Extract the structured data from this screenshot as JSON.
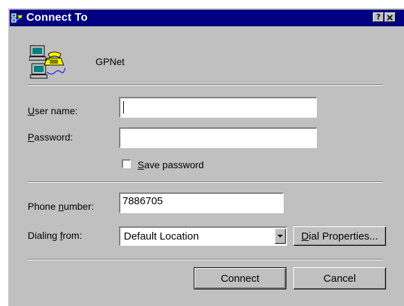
{
  "window": {
    "title": "Connect To",
    "help_label": "?",
    "close_label": "✕"
  },
  "entry": {
    "name": "GPNet",
    "icon": "dialup-connection-icon"
  },
  "credentials": {
    "username_label_key": "U",
    "username_label_rest": "ser name:",
    "username_value": "",
    "password_label_key": "P",
    "password_label_rest": "assword:",
    "password_value": "",
    "save_password_key": "S",
    "save_password_rest": "ave password",
    "save_password_checked": false
  },
  "dialing": {
    "phone_label_pre": "Phone ",
    "phone_label_key": "n",
    "phone_label_rest": "umber:",
    "phone_value": "7886705",
    "from_label_pre": "Dialing ",
    "from_label_key": "f",
    "from_label_rest": "rom:",
    "from_value": "Default Location",
    "dial_props_key": "D",
    "dial_props_rest": "ial Properties..."
  },
  "actions": {
    "connect_label": "Connect",
    "cancel_label": "Cancel"
  },
  "colors": {
    "titlebar": "#000080",
    "dialog_face": "#c0c0c0"
  }
}
